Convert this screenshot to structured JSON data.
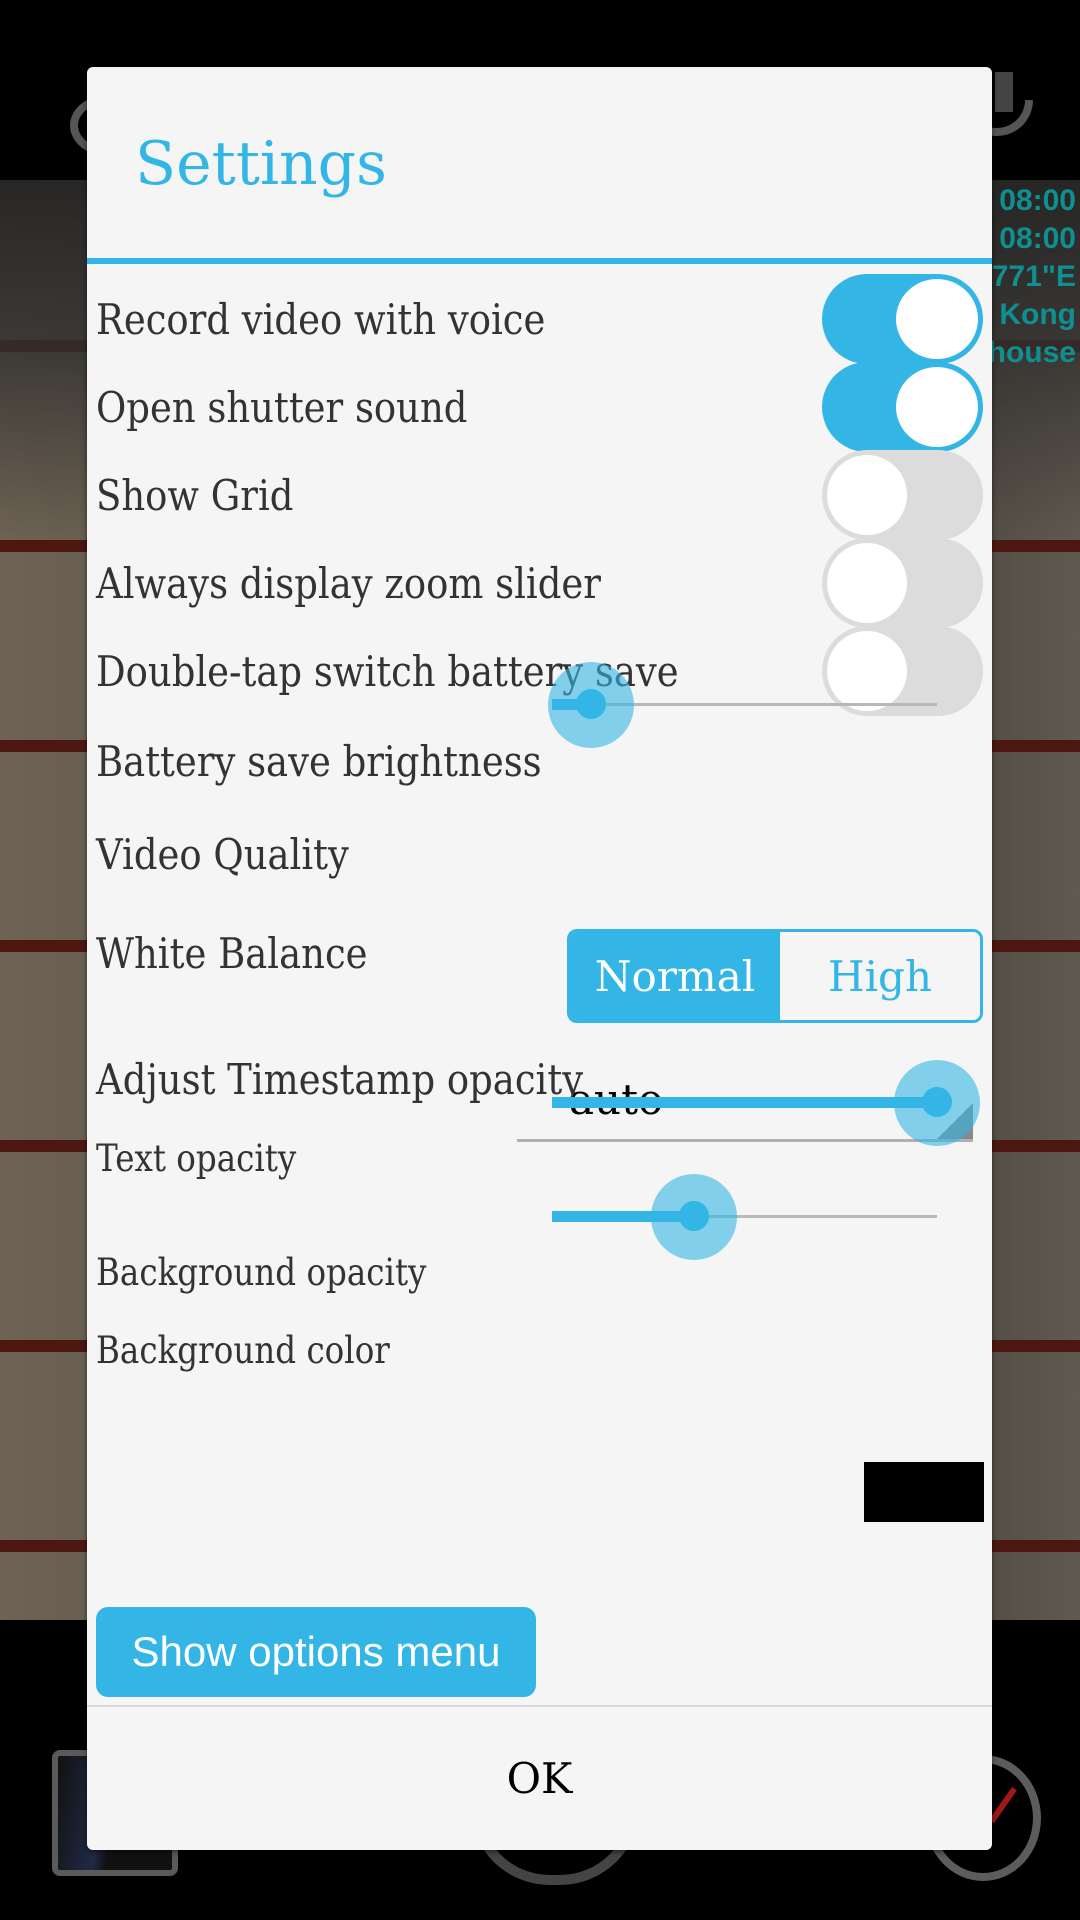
{
  "background": {
    "timestamp_overlay": [
      "08:00",
      "08:00",
      "771\"E",
      "Kong",
      "house"
    ],
    "timestamp_color": "#0f8f8f"
  },
  "dialog": {
    "title": "Settings",
    "accent_color": "#33b5e5",
    "toggles": [
      {
        "label": "Record video with voice",
        "on": true
      },
      {
        "label": "Open shutter sound",
        "on": true
      },
      {
        "label": "Show Grid",
        "on": false
      },
      {
        "label": "Always display zoom slider",
        "on": false
      },
      {
        "label": "Double-tap switch battery save",
        "on": false
      }
    ],
    "battery_save_brightness": {
      "label": "Battery save brightness",
      "value_fraction": 0.1
    },
    "video_quality": {
      "label": "Video Quality",
      "options": [
        "Normal",
        "High"
      ],
      "selected": "Normal"
    },
    "white_balance": {
      "label": "White Balance",
      "value": "auto"
    },
    "timestamp_section": {
      "heading": "Adjust Timestamp opacity",
      "text_opacity": {
        "label": "Text opacity",
        "value_fraction": 1.0
      },
      "background_opacity": {
        "label": "Background opacity",
        "value_fraction": 0.37
      },
      "background_color": {
        "label": "Background color",
        "value": "#000000"
      }
    },
    "show_options_button": "Show options menu",
    "ok_button": "OK"
  }
}
